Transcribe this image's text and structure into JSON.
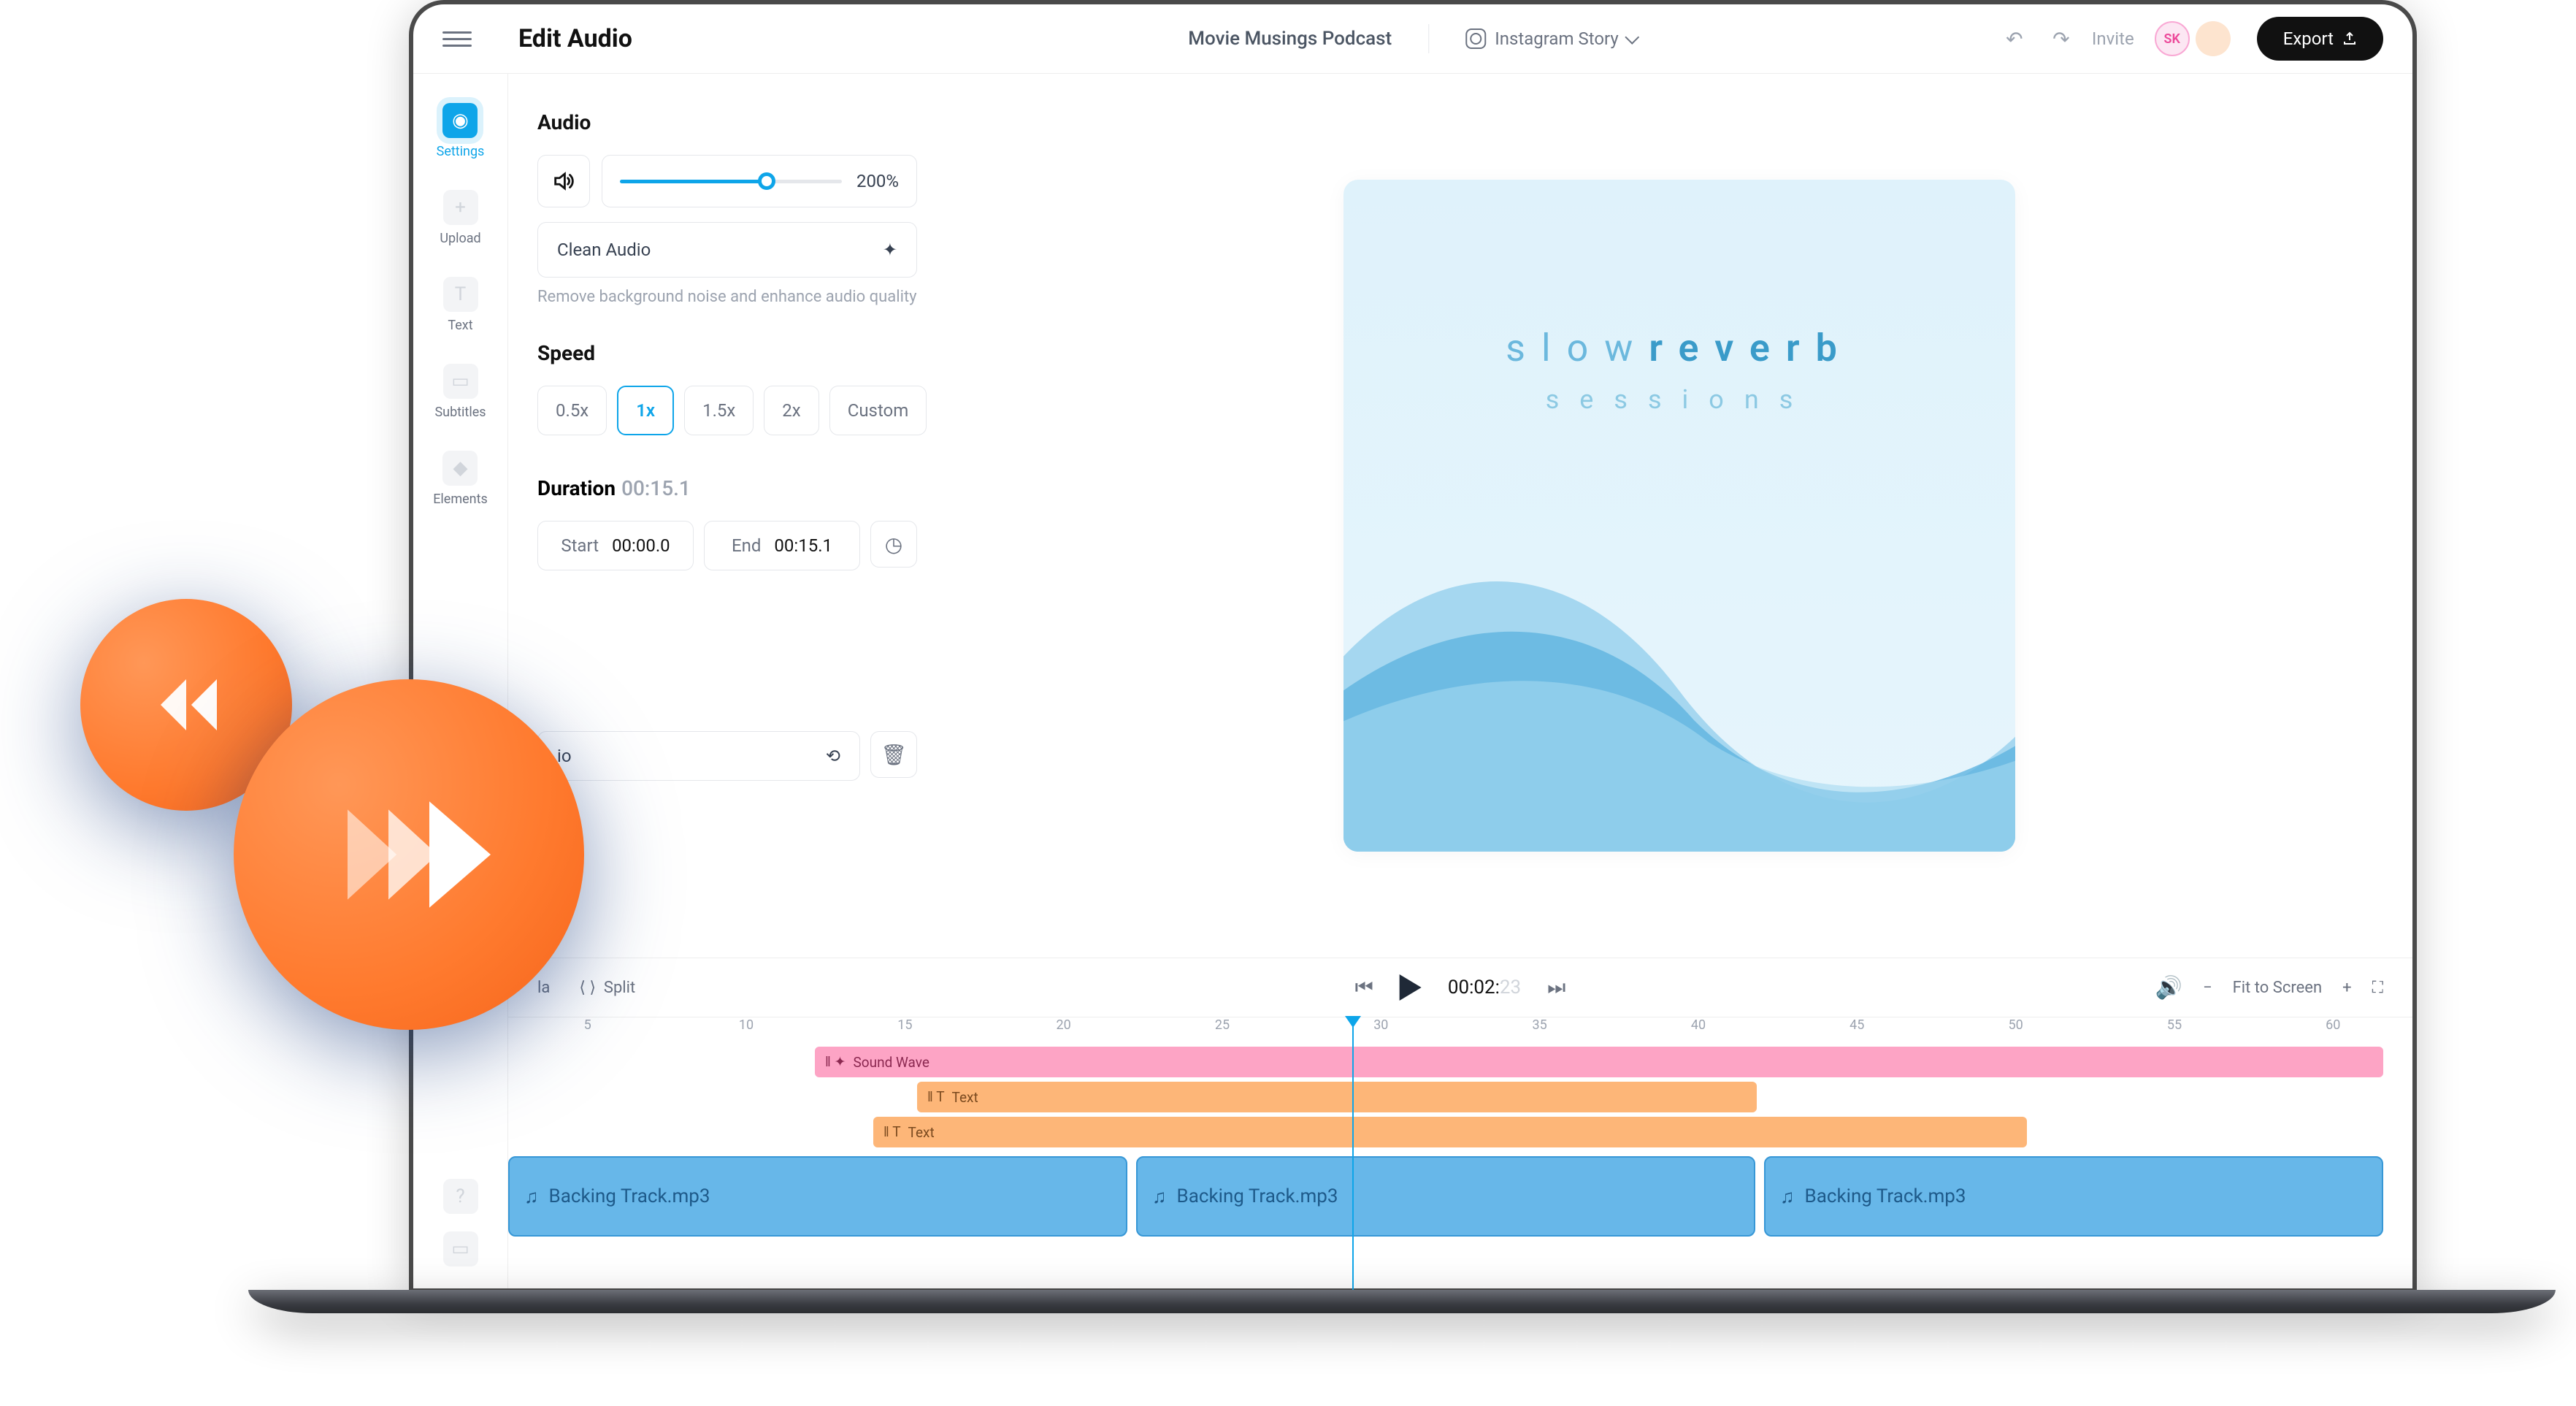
{
  "header": {
    "title": "Edit Audio",
    "project": "Movie Musings Podcast",
    "format": "Instagram Story",
    "invite": "Invite",
    "avatar1": "SK",
    "export": "Export"
  },
  "sidebar": {
    "items": [
      {
        "label": "Settings",
        "icon": "target"
      },
      {
        "label": "Upload",
        "icon": "plus"
      },
      {
        "label": "Text",
        "icon": "T"
      },
      {
        "label": "Subtitles",
        "icon": "cc"
      },
      {
        "label": "Elements",
        "icon": "shape"
      }
    ]
  },
  "audio": {
    "heading": "Audio",
    "volume_pct": "200%",
    "clean": "Clean Audio",
    "helper": "Remove background noise and enhance audio quality"
  },
  "speed": {
    "heading": "Speed",
    "options": [
      "0.5x",
      "1x",
      "1.5x",
      "2x",
      "Custom"
    ],
    "selected": "1x"
  },
  "duration": {
    "heading": "Duration",
    "value": "00:15.1",
    "start_label": "Start",
    "start_value": "00:00.0",
    "end_label": "End",
    "end_value": "00:15.1"
  },
  "replace": {
    "suffix": "io"
  },
  "canvas": {
    "title_a": "slow",
    "title_b": "reverb",
    "subtitle": "sessions"
  },
  "controls": {
    "split": "Split",
    "time_done": "00:02:",
    "time_rem": "23",
    "fit": "Fit to Screen"
  },
  "ruler": [
    "5",
    "10",
    "15",
    "20",
    "25",
    "30",
    "35",
    "40",
    "45",
    "50",
    "55",
    "60"
  ],
  "tracks": {
    "soundwave": "Sound Wave",
    "text1": "Text",
    "text2": "Text",
    "audio1": "Backing Track.mp3",
    "audio2": "Backing Track.mp3",
    "audio3": "Backing Track.mp3"
  }
}
